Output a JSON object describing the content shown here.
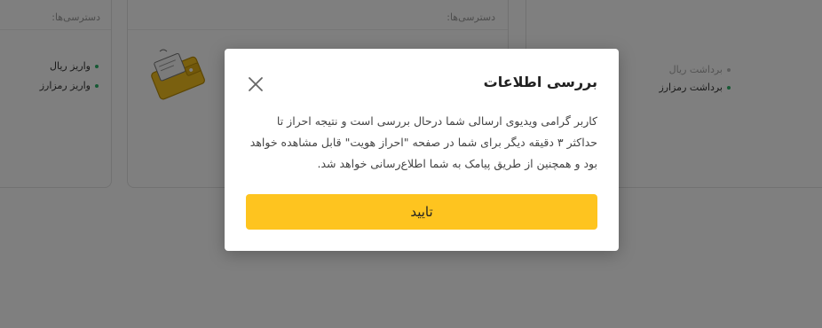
{
  "background": {
    "cards": [
      {
        "title": "دسترسی‌ها:",
        "items": [
          "واریز ریال",
          "واریز رمزارز"
        ]
      },
      {
        "title": "دسترسی‌ها:"
      },
      {
        "items": [
          "برداشت ریال",
          "برداشت رمزارز"
        ]
      }
    ]
  },
  "modal": {
    "title": "بررسی اطلاعات",
    "body": "کاربر گرامی ویدیوی ارسالی شما درحال بررسی است و نتیجه احراز تا حداکثر ۳ دقیقه دیگر برای شما در صفحه \"احراز هویت\" قابل مشاهده خواهد بود و همچنین از طریق پیامک به شما اطلاع‌رسانی خواهد شد.",
    "confirm_label": "تایید",
    "close_icon": "close-icon"
  },
  "colors": {
    "accent": "#fec41f",
    "overlay": "rgba(0,0,0,0.5)"
  }
}
